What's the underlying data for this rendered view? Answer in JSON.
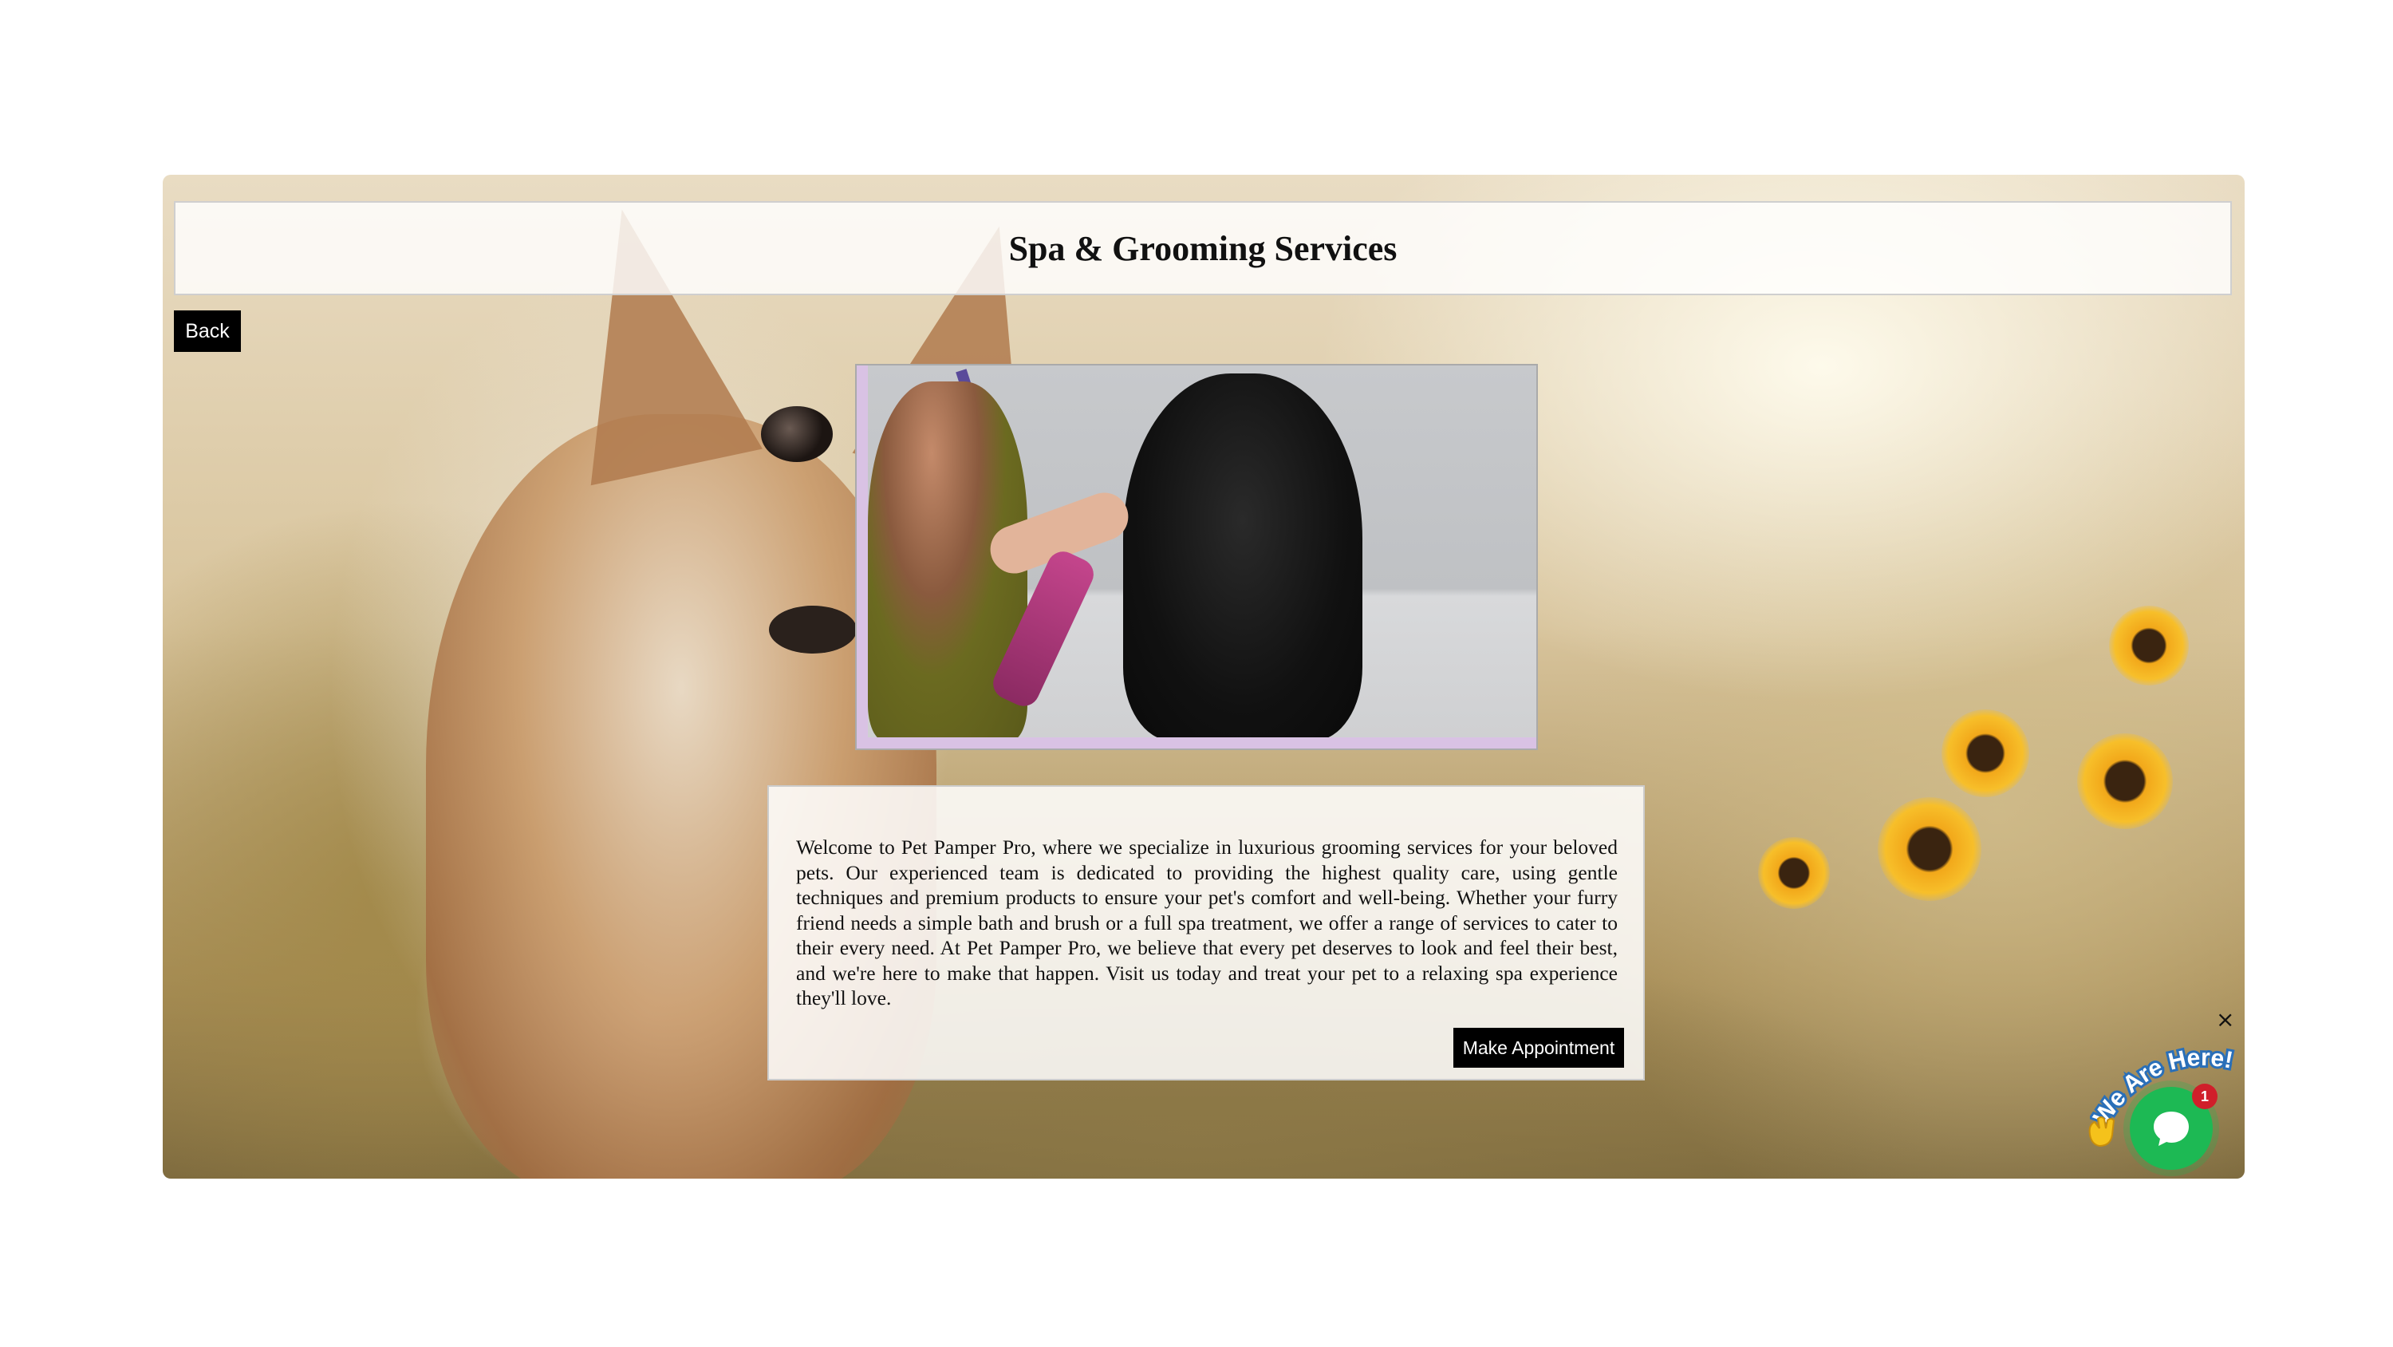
{
  "header": {
    "title": "Spa & Grooming Services"
  },
  "nav": {
    "back_label": "Back"
  },
  "hero_photo": {
    "alt": "Groomer trimming a black poodle with pink clippers"
  },
  "description": {
    "text": "Welcome to Pet Pamper Pro, where we specialize in luxurious grooming services for your beloved pets. Our experienced team is dedicated to providing the highest quality care, using gentle techniques and premium products to ensure your pet's comfort and well-being. Whether your furry friend needs a simple bath and brush or a full spa treatment, we offer a range of services to cater to their every need. At Pet Pamper Pro, we believe that every pet deserves to look and feel their best, and we're here to make that happen. Visit us today and treat your pet to a relaxing spa experience they'll love.",
    "cta_label": "Make Appointment"
  },
  "chat_widget": {
    "label": "We Are Here!",
    "close_glyph": "×",
    "unread_count": "1",
    "accent_color": "#1db954",
    "badge_color": "#d01f2a"
  }
}
